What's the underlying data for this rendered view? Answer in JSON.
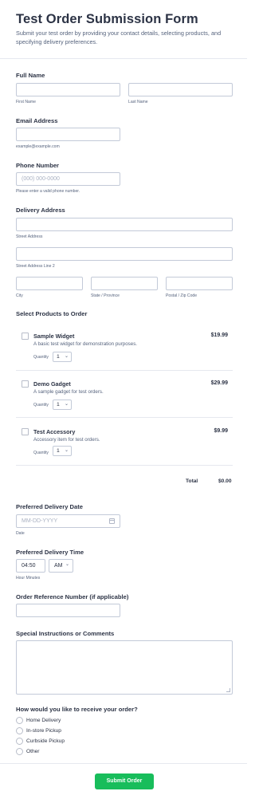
{
  "header": {
    "title": "Test Order Submission Form",
    "subtitle": "Submit your test order by providing your contact details, selecting products, and specifying delivery preferences."
  },
  "full_name": {
    "label": "Full Name",
    "first_sublabel": "First Name",
    "last_sublabel": "Last Name"
  },
  "email": {
    "label": "Email Address",
    "sublabel": "example@example.com"
  },
  "phone": {
    "label": "Phone Number",
    "placeholder": "(000) 000-0000",
    "sublabel": "Please enter a valid phone number."
  },
  "address": {
    "label": "Delivery Address",
    "street_sublabel": "Street Address",
    "street2_sublabel": "Street Address Line 2",
    "city_sublabel": "City",
    "state_sublabel": "State / Province",
    "zip_sublabel": "Postal / Zip Code"
  },
  "products": {
    "label": "Select Products to Order",
    "quantity_label": "Quantity",
    "items": [
      {
        "name": "Sample Widget",
        "description": "A basic test widget for demonstration purposes.",
        "price": "$19.99",
        "quantity": "1"
      },
      {
        "name": "Demo Gadget",
        "description": "A sample gadget for test orders.",
        "price": "$29.99",
        "quantity": "1"
      },
      {
        "name": "Test Accessory",
        "description": "Accessory item for test orders.",
        "price": "$9.99",
        "quantity": "1"
      }
    ],
    "total_label": "Total",
    "total_value": "$0.00"
  },
  "delivery_date": {
    "label": "Preferred Delivery Date",
    "placeholder": "MM-DD-YYYY",
    "sublabel": "Date",
    "icon": "calendar-icon"
  },
  "delivery_time": {
    "label": "Preferred Delivery Time",
    "time_value": "04:50",
    "ampm_value": "AM",
    "sublabel": "Hour Minutes"
  },
  "order_reference": {
    "label": "Order Reference Number (if applicable)"
  },
  "instructions": {
    "label": "Special Instructions or Comments"
  },
  "receive_method": {
    "label": "How would you like to receive your order?",
    "options": [
      "Home Delivery",
      "In-store Pickup",
      "Curbside Pickup",
      "Other"
    ]
  },
  "submit": {
    "label": "Submit Order"
  },
  "colors": {
    "accent": "#18bd5b",
    "text": "#2c3345",
    "muted": "#57647e",
    "border": "#c3cad8"
  }
}
